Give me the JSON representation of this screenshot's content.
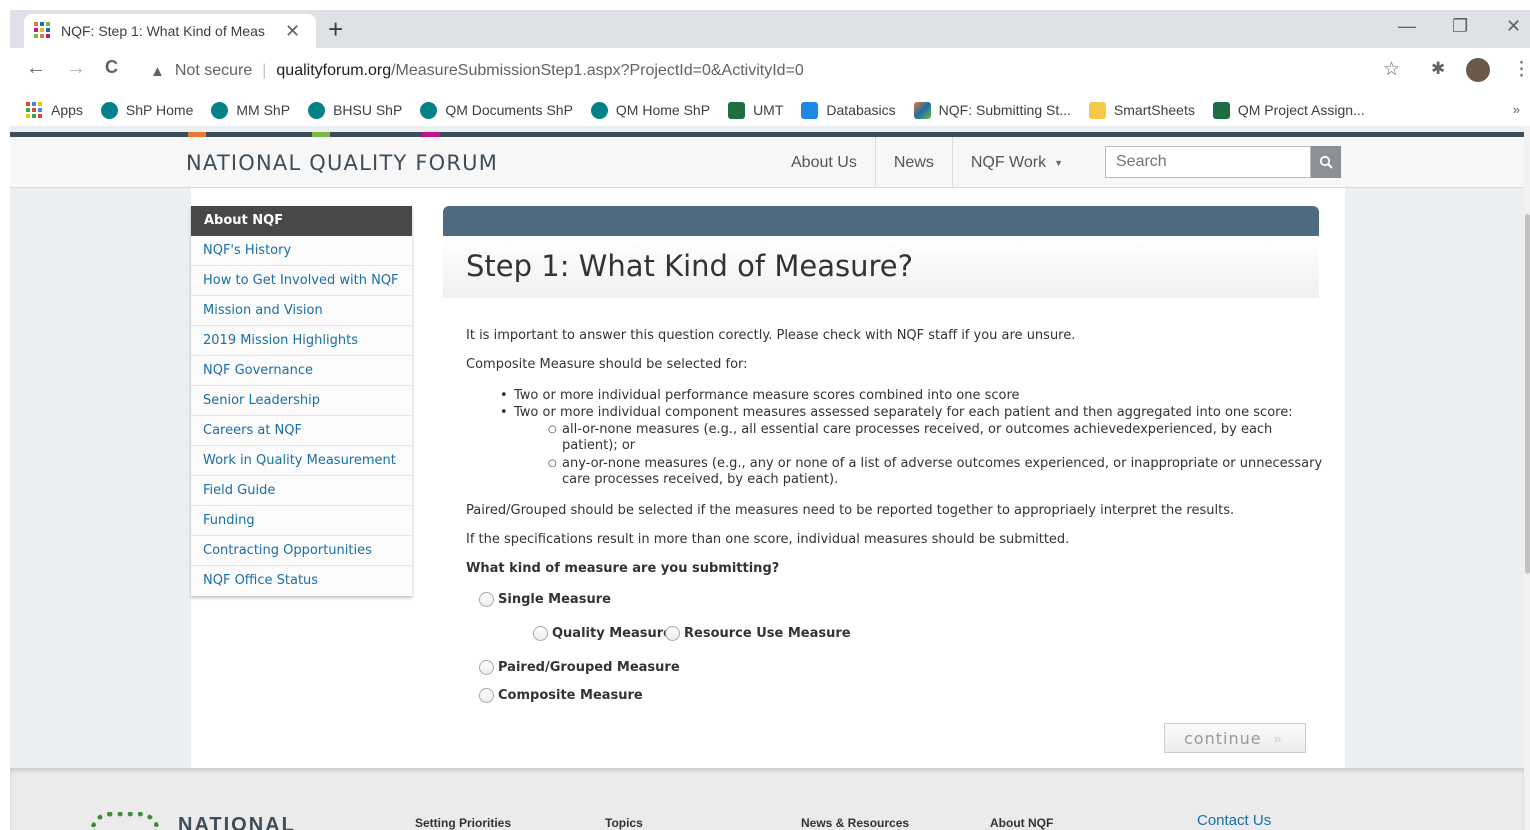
{
  "browser": {
    "tab_title": "NQF: Step 1: What Kind of Meas",
    "tab_close": "✕",
    "new_tab": "+",
    "window_controls": [
      "—",
      "❐",
      "✕"
    ],
    "nav": {
      "back": "←",
      "forward": "→",
      "reload": "C"
    },
    "security_label": "Not secure",
    "url_domain": "qualityforum.org",
    "url_path": "/MeasureSubmissionStep1.aspx?ProjectId=0&ActivityId=0",
    "toolbar_icons": [
      "star-icon",
      "extensions-icon",
      "avatar",
      "menu-icon"
    ],
    "bookmarks": [
      {
        "label": "Apps",
        "icon": "apps-icon"
      },
      {
        "label": "ShP Home",
        "icon": "sharepoint-icon"
      },
      {
        "label": "MM ShP",
        "icon": "sharepoint-icon"
      },
      {
        "label": "BHSU ShP",
        "icon": "sharepoint-icon"
      },
      {
        "label": "QM Documents ShP",
        "icon": "sharepoint-icon"
      },
      {
        "label": "QM Home ShP",
        "icon": "sharepoint-icon"
      },
      {
        "label": "UMT",
        "icon": "excel-icon"
      },
      {
        "label": "Databasics",
        "icon": "d-icon"
      },
      {
        "label": "NQF: Submitting St...",
        "icon": "nqf-icon"
      },
      {
        "label": "SmartSheets",
        "icon": "folder-icon"
      },
      {
        "label": "QM Project Assign...",
        "icon": "excel-icon"
      }
    ],
    "bookmarks_more": "»"
  },
  "site": {
    "logo": "NATIONAL QUALITY FORUM",
    "nav": [
      "About Us",
      "News",
      "NQF Work"
    ],
    "search_placeholder": "Search"
  },
  "sidebar": {
    "heading": "About NQF",
    "items": [
      "NQF's History",
      "How to Get Involved with NQF",
      "Mission and Vision",
      "2019 Mission Highlights",
      "NQF Governance",
      "Senior Leadership",
      "Careers at NQF",
      "Work in Quality Measurement",
      "Field Guide",
      "Funding",
      "Contracting Opportunities",
      "NQF Office Status"
    ]
  },
  "main": {
    "title": "Step 1: What Kind of Measure?",
    "intro": "It is important to answer this question corectly. Please check with NQF staff if you are unsure.",
    "composite_heading": "Composite Measure should be selected for:",
    "bullets": [
      "Two or more individual performance measure scores combined into one score",
      "Two or more individual component measures assessed separately for each patient and then aggregated into one score:"
    ],
    "sub_bullets": [
      "all-or-none measures (e.g., all essential care processes received, or outcomes achievedexperienced, by each",
      "patient); or",
      "any-or-none measures (e.g., any or none of a list of adverse outcomes experienced, or inappropriate or unnecessary",
      "care processes received, by each patient)."
    ],
    "paired_note": "Paired/Grouped should be selected if the measures need to be reported together to appropriaely interpret the results.",
    "spec_note": "If the specifications result in more than one score, individual measures should be submitted.",
    "question": "What kind of measure are you submitting?",
    "options": {
      "single": "Single Measure",
      "quality": "Quality Measure",
      "resource": "Resource Use Measure",
      "paired": "Paired/Grouped Measure",
      "composite": "Composite Measure"
    },
    "continue_label": "continue",
    "continue_arrows": "»"
  },
  "footer": {
    "logo": "NATIONAL",
    "links": [
      "Setting Priorities",
      "Topics",
      "News & Resources",
      "About NQF"
    ],
    "contact": "Contact Us"
  },
  "colors": {
    "brand_dark": "#3d4d5a",
    "link_blue": "#1a6fa6",
    "panel_bar": "#4e6b82",
    "strip_orange": "#e8792f",
    "strip_green": "#7ab648",
    "strip_magenta": "#c2158a"
  }
}
